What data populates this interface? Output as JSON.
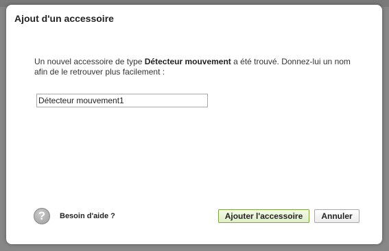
{
  "dialog": {
    "title": "Ajout d'un accessoire",
    "message_prefix": "Un nouvel accessoire de type ",
    "accessory_type": "Détecteur mouvement",
    "message_suffix": " a été trouvé. Donnez-lui un nom afin de le retrouver plus facilement :",
    "name_value": "Détecteur mouvement1",
    "help_icon": "help-question-icon",
    "help_label": "Besoin d'aide ?",
    "add_button_label": "Ajouter l'accessoire",
    "cancel_button_label": "Annuler"
  },
  "colors": {
    "primary_button_border": "#7da640",
    "primary_button_bg": "#dfeec6",
    "overlay": "#878787"
  }
}
